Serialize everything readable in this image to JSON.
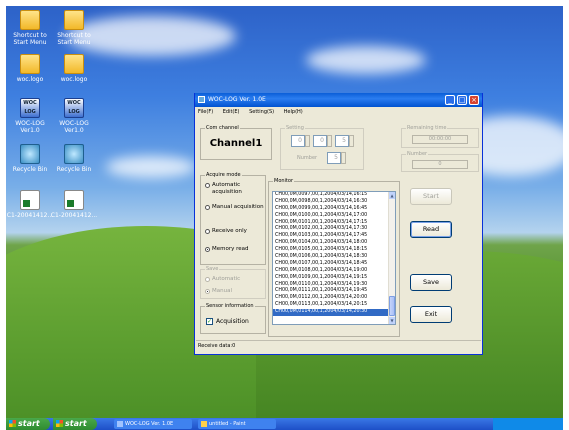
{
  "desktop_icons": [
    {
      "name": "shortcut-start-menu-1",
      "label": "Shortcut to Start Menu",
      "icon": "folder-shortcut-icon"
    },
    {
      "name": "shortcut-start-menu-2",
      "label": "Shortcut to Start Menu",
      "icon": "folder-shortcut-icon"
    },
    {
      "name": "woc-logo-folder-1",
      "label": "woc.logo",
      "icon": "folder-icon"
    },
    {
      "name": "woc-logo-folder-2",
      "label": "woc.logo",
      "icon": "folder-icon"
    },
    {
      "name": "woc-log-app-1",
      "label": "WOC-LOG Ver1.0",
      "icon": "woc-app-icon",
      "glyph": "WOC LOG"
    },
    {
      "name": "woc-log-app-2",
      "label": "WOC-LOG Ver1.0",
      "icon": "woc-app-icon",
      "glyph": "WOC LOG"
    },
    {
      "name": "recycle-bin-1",
      "label": "Recycle Bin",
      "icon": "recycle-bin-icon"
    },
    {
      "name": "recycle-bin-2",
      "label": "Recycle Bin",
      "icon": "recycle-bin-icon"
    },
    {
      "name": "csv-file-1",
      "label": "C1-20041412...",
      "icon": "spreadsheet-file-icon"
    },
    {
      "name": "csv-file-2",
      "label": "C1-20041412...",
      "icon": "spreadsheet-file-icon"
    }
  ],
  "taskbar": {
    "start_1": "start",
    "start_2": "start",
    "tasks": [
      "WOC-LOG Ver. 1.0E",
      "untitled - Paint"
    ]
  },
  "window": {
    "title": "WOC-LOG Ver. 1.0E",
    "menu": [
      "File(F)",
      "Edit(E)",
      "Setting(S)",
      "Help(H)"
    ],
    "com_channel": {
      "label": "Com channel",
      "value": "Channel1"
    },
    "setting": {
      "label": "Setting",
      "fields": [
        "0",
        "0",
        "5"
      ],
      "number_label": "Number",
      "number_value": "5"
    },
    "remaining_time": {
      "label": "Remaining time",
      "value": "00:00:00"
    },
    "number_box": {
      "label": "Number",
      "value": "0"
    },
    "acquire_mode": {
      "label": "Acquire mode",
      "options": [
        {
          "text": "Automatic acquisition",
          "checked": false
        },
        {
          "text": "Manual acquisition",
          "checked": false
        },
        {
          "text": "Receive only",
          "checked": false
        },
        {
          "text": "Memory read",
          "checked": true
        }
      ]
    },
    "save_group": {
      "label": "Save",
      "options": [
        {
          "text": "Automatic",
          "checked": false
        },
        {
          "text": "Manual",
          "checked": true
        }
      ]
    },
    "sensor": {
      "label": "Sensor information",
      "checkbox_label": "Acquisition",
      "checked": true
    },
    "monitor": {
      "label": "Monitor",
      "rows": [
        "CH00,0M,0097,00,1,2004/03/14,16:15",
        "CH00,0M,0098,00,1,2004/03/14,16:30",
        "CH00,0M,0099,00,1,2004/03/14,16:45",
        "CH00,0M,0100,00,1,2004/03/14,17:00",
        "CH00,0M,0101,00,1,2004/03/14,17:15",
        "CH00,0M,0102,00,1,2004/03/14,17:30",
        "CH00,0M,0103,00,1,2004/03/14,17:45",
        "CH00,0M,0104,00,1,2004/03/14,18:00",
        "CH00,0M,0105,00,1,2004/03/14,18:15",
        "CH00,0M,0106,00,1,2004/03/14,18:30",
        "CH00,0M,0107,00,1,2004/03/14,18:45",
        "CH00,0M,0108,00,1,2004/03/14,19:00",
        "CH00,0M,0109,00,1,2004/03/14,19:15",
        "CH00,0M,0110,00,1,2004/03/14,19:30",
        "CH00,0M,0111,00,1,2004/03/14,19:45",
        "CH00,0M,0112,00,1,2004/03/14,20:00",
        "CH00,0M,0113,00,1,2004/03/14,20:15",
        "CH00,0M,0114,00,1,2004/03/14,20:30"
      ],
      "selected_index": 17
    },
    "buttons": {
      "start": "Start",
      "read": "Read",
      "save": "Save",
      "exit": "Exit"
    },
    "status": "Receive data:0"
  },
  "colors": {
    "titlebar": "#0a5ed8",
    "selection": "#316ac5",
    "window_bg": "#ece9d8"
  }
}
